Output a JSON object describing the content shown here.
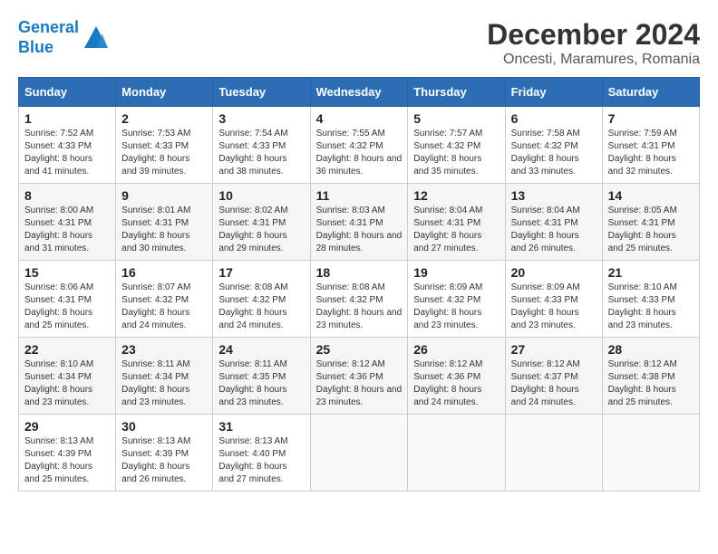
{
  "header": {
    "logo_line1": "General",
    "logo_line2": "Blue",
    "month_year": "December 2024",
    "location": "Oncesti, Maramures, Romania"
  },
  "weekdays": [
    "Sunday",
    "Monday",
    "Tuesday",
    "Wednesday",
    "Thursday",
    "Friday",
    "Saturday"
  ],
  "weeks": [
    [
      {
        "day": "1",
        "sunrise": "7:52 AM",
        "sunset": "4:33 PM",
        "daylight": "8 hours and 41 minutes."
      },
      {
        "day": "2",
        "sunrise": "7:53 AM",
        "sunset": "4:33 PM",
        "daylight": "8 hours and 39 minutes."
      },
      {
        "day": "3",
        "sunrise": "7:54 AM",
        "sunset": "4:33 PM",
        "daylight": "8 hours and 38 minutes."
      },
      {
        "day": "4",
        "sunrise": "7:55 AM",
        "sunset": "4:32 PM",
        "daylight": "8 hours and 36 minutes."
      },
      {
        "day": "5",
        "sunrise": "7:57 AM",
        "sunset": "4:32 PM",
        "daylight": "8 hours and 35 minutes."
      },
      {
        "day": "6",
        "sunrise": "7:58 AM",
        "sunset": "4:32 PM",
        "daylight": "8 hours and 33 minutes."
      },
      {
        "day": "7",
        "sunrise": "7:59 AM",
        "sunset": "4:31 PM",
        "daylight": "8 hours and 32 minutes."
      }
    ],
    [
      {
        "day": "8",
        "sunrise": "8:00 AM",
        "sunset": "4:31 PM",
        "daylight": "8 hours and 31 minutes."
      },
      {
        "day": "9",
        "sunrise": "8:01 AM",
        "sunset": "4:31 PM",
        "daylight": "8 hours and 30 minutes."
      },
      {
        "day": "10",
        "sunrise": "8:02 AM",
        "sunset": "4:31 PM",
        "daylight": "8 hours and 29 minutes."
      },
      {
        "day": "11",
        "sunrise": "8:03 AM",
        "sunset": "4:31 PM",
        "daylight": "8 hours and 28 minutes."
      },
      {
        "day": "12",
        "sunrise": "8:04 AM",
        "sunset": "4:31 PM",
        "daylight": "8 hours and 27 minutes."
      },
      {
        "day": "13",
        "sunrise": "8:04 AM",
        "sunset": "4:31 PM",
        "daylight": "8 hours and 26 minutes."
      },
      {
        "day": "14",
        "sunrise": "8:05 AM",
        "sunset": "4:31 PM",
        "daylight": "8 hours and 25 minutes."
      }
    ],
    [
      {
        "day": "15",
        "sunrise": "8:06 AM",
        "sunset": "4:31 PM",
        "daylight": "8 hours and 25 minutes."
      },
      {
        "day": "16",
        "sunrise": "8:07 AM",
        "sunset": "4:32 PM",
        "daylight": "8 hours and 24 minutes."
      },
      {
        "day": "17",
        "sunrise": "8:08 AM",
        "sunset": "4:32 PM",
        "daylight": "8 hours and 24 minutes."
      },
      {
        "day": "18",
        "sunrise": "8:08 AM",
        "sunset": "4:32 PM",
        "daylight": "8 hours and 23 minutes."
      },
      {
        "day": "19",
        "sunrise": "8:09 AM",
        "sunset": "4:32 PM",
        "daylight": "8 hours and 23 minutes."
      },
      {
        "day": "20",
        "sunrise": "8:09 AM",
        "sunset": "4:33 PM",
        "daylight": "8 hours and 23 minutes."
      },
      {
        "day": "21",
        "sunrise": "8:10 AM",
        "sunset": "4:33 PM",
        "daylight": "8 hours and 23 minutes."
      }
    ],
    [
      {
        "day": "22",
        "sunrise": "8:10 AM",
        "sunset": "4:34 PM",
        "daylight": "8 hours and 23 minutes."
      },
      {
        "day": "23",
        "sunrise": "8:11 AM",
        "sunset": "4:34 PM",
        "daylight": "8 hours and 23 minutes."
      },
      {
        "day": "24",
        "sunrise": "8:11 AM",
        "sunset": "4:35 PM",
        "daylight": "8 hours and 23 minutes."
      },
      {
        "day": "25",
        "sunrise": "8:12 AM",
        "sunset": "4:36 PM",
        "daylight": "8 hours and 23 minutes."
      },
      {
        "day": "26",
        "sunrise": "8:12 AM",
        "sunset": "4:36 PM",
        "daylight": "8 hours and 24 minutes."
      },
      {
        "day": "27",
        "sunrise": "8:12 AM",
        "sunset": "4:37 PM",
        "daylight": "8 hours and 24 minutes."
      },
      {
        "day": "28",
        "sunrise": "8:12 AM",
        "sunset": "4:38 PM",
        "daylight": "8 hours and 25 minutes."
      }
    ],
    [
      {
        "day": "29",
        "sunrise": "8:13 AM",
        "sunset": "4:39 PM",
        "daylight": "8 hours and 25 minutes."
      },
      {
        "day": "30",
        "sunrise": "8:13 AM",
        "sunset": "4:39 PM",
        "daylight": "8 hours and 26 minutes."
      },
      {
        "day": "31",
        "sunrise": "8:13 AM",
        "sunset": "4:40 PM",
        "daylight": "8 hours and 27 minutes."
      },
      null,
      null,
      null,
      null
    ]
  ]
}
